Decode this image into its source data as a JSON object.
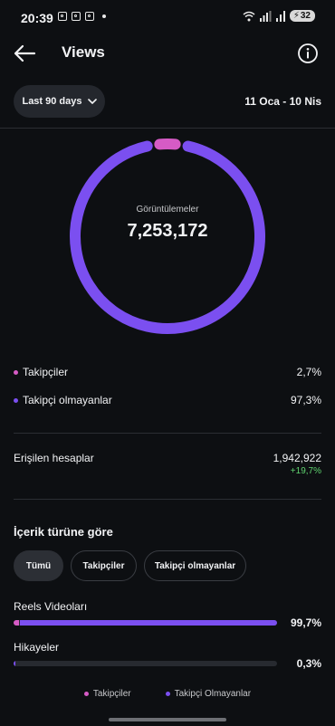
{
  "status_bar": {
    "time": "20:39",
    "battery": "32"
  },
  "header": {
    "title": "Views"
  },
  "filters": {
    "range_label": "Last 90 days",
    "date_range": "11 Oca - 10 Nis"
  },
  "colors": {
    "followers": "#d65bc5",
    "non_followers": "#7b4ff0",
    "positive": "#5fd36f"
  },
  "summary": {
    "donut_label": "Görüntülemeler",
    "total_views": "7,253,172",
    "followers_fraction": 0.027,
    "non_followers_fraction": 0.973
  },
  "breakdown": [
    {
      "label": "Takipçiler",
      "value": "2,7%",
      "color": "#d65bc5"
    },
    {
      "label": "Takipçi olmayanlar",
      "value": "97,3%",
      "color": "#7b4ff0"
    }
  ],
  "reach": {
    "label": "Erişilen hesaplar",
    "value": "1,942,922",
    "delta": "+19,7%"
  },
  "content_type": {
    "title": "İçerik türüne göre",
    "tabs": [
      "Tümü",
      "Takipçiler",
      "Takipçi olmayanlar"
    ],
    "active_tab": "Tümü",
    "rows": [
      {
        "label": "Reels Videoları",
        "value": "99,7%",
        "followers_fraction": 0.02,
        "non_followers_fraction": 0.977
      },
      {
        "label": "Hikayeler",
        "value": "0,3%",
        "followers_fraction": 0.0,
        "non_followers_fraction": 0.003
      }
    ]
  },
  "legend": [
    "Takipçiler",
    "Takipçi Olmayanlar"
  ]
}
